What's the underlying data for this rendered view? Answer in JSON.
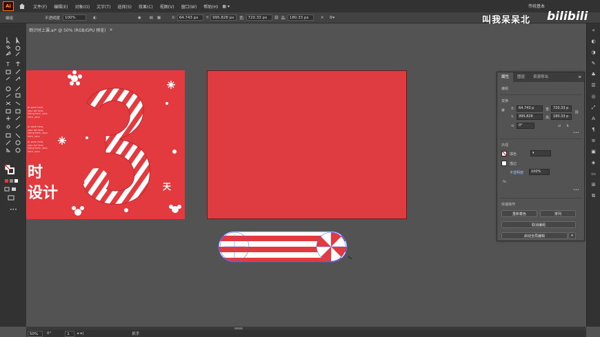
{
  "app": {
    "logo": "Ai"
  },
  "menu": [
    "文件(F)",
    "编辑(E)",
    "对象(O)",
    "文字(T)",
    "选择(S)",
    "效果(C)",
    "视图(V)",
    "窗口(W)",
    "帮助(H)"
  ],
  "workspace": "传统基本",
  "control_bar": {
    "mode_label": "编组",
    "opacity_label": "不透明度",
    "opacity_value": "100%",
    "x_value": "64.743 px",
    "y_value": "995.828 px",
    "w_value": "720.33 px",
    "h_value": "180.33 px"
  },
  "document_tab": {
    "title": "倒计时上课.ai* @ 50% (RGB/GPU 预览)",
    "close": "×"
  },
  "artboard_left": {
    "big_number": "3",
    "text_line1": "时",
    "text_line2": "设计",
    "day_char": "天",
    "small_text_blocks": [
      "ar work here, your ad here, tyling here, your here, your",
      "ar work here, your ad here, tyling here, your here, your",
      "ar work here, your ad here, tyling here, your here, your"
    ]
  },
  "properties_panel": {
    "tabs": [
      "属性",
      "图层",
      "资源导出"
    ],
    "section_group": "编组",
    "section_transform": "变换",
    "x_label": "X:",
    "x_value": "64.743 p",
    "y_label": "Y:",
    "y_value": "995.828",
    "w_label": "宽:",
    "w_value": "720.33 p",
    "h_label": "高:",
    "h_value": "180.33 p",
    "angle_value": "0°",
    "section_appearance": "外观",
    "fill_label": "填色",
    "stroke_label": "描边",
    "opacity_label": "不透明度",
    "opacity_value": "100%",
    "fx_label": "fx.",
    "more": "•••",
    "section_quick": "快速操作",
    "btn_recolor": "重新着色",
    "btn_arrange": "排列",
    "btn_ungroup": "取消编组",
    "btn_start_global": "启动全局编辑"
  },
  "status_bar": {
    "zoom": "50%",
    "rotation": "0°",
    "artboard": "1",
    "tool": "抓手"
  },
  "watermark": {
    "text": "叫我呆呆北",
    "logo": "bilibili"
  },
  "colors": {
    "artboard_red": "#e23a3e",
    "ui_dark": "#323232",
    "ui_mid": "#535353"
  }
}
